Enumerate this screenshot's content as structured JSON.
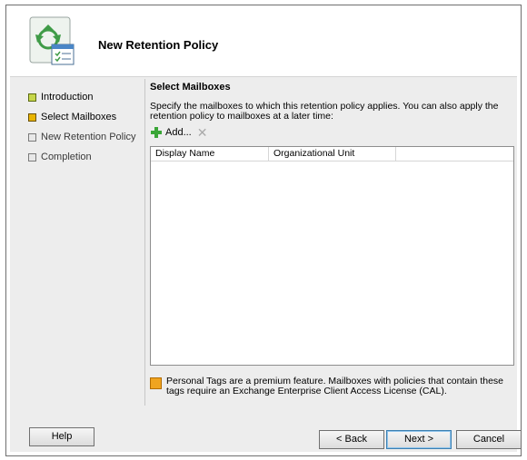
{
  "wizard": {
    "title": "New Retention Policy",
    "icon": "recycle-policy-icon"
  },
  "steps": [
    {
      "label": "Introduction",
      "state": "done"
    },
    {
      "label": "Select Mailboxes",
      "state": "current"
    },
    {
      "label": "New Retention Policy",
      "state": "pending"
    },
    {
      "label": "Completion",
      "state": "pending"
    }
  ],
  "page": {
    "section_title": "Select Mailboxes",
    "description": "Specify the mailboxes to which this retention policy applies. You can also apply the retention policy to mailboxes at a later time:",
    "add_label": "Add...",
    "columns": [
      "Display Name",
      "Organizational Unit",
      ""
    ],
    "note": "Personal Tags are a premium feature. Mailboxes with policies that contain these tags require an Exchange Enterprise Client Access License (CAL)."
  },
  "buttons": {
    "help": "Help",
    "back": "< Back",
    "next": "Next >",
    "cancel": "Cancel"
  },
  "colors": {
    "step_done": "#c6d64a",
    "step_current": "#e8b400",
    "note_icon": "#f0a420"
  }
}
